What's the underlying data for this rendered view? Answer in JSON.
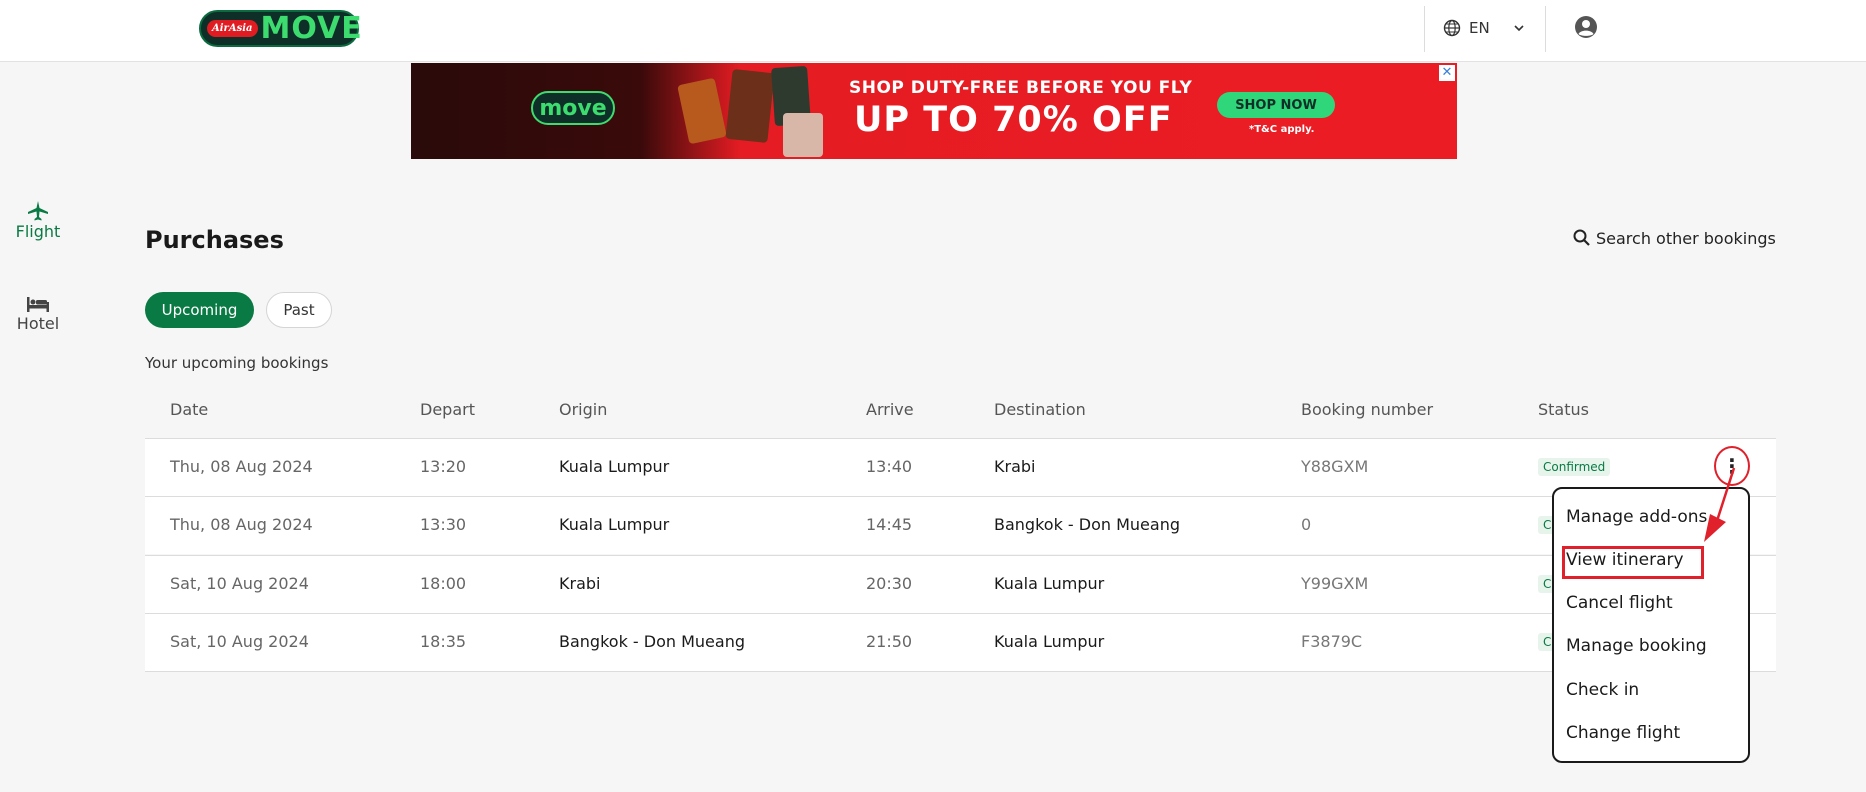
{
  "header": {
    "logo_badge": "AirAsia",
    "logo_text": "MOVE",
    "language": "EN"
  },
  "ad": {
    "logo_text": "move",
    "line1": "SHOP DUTY-FREE BEFORE YOU FLY",
    "line2": "UP TO 70% OFF",
    "cta": "SHOP NOW",
    "tc": "*T&C apply.",
    "close": "✕"
  },
  "sidenav": {
    "flight": "Flight",
    "hotel": "Hotel"
  },
  "main": {
    "title": "Purchases",
    "search_label": "Search other bookings",
    "tabs": {
      "upcoming": "Upcoming",
      "past": "Past"
    },
    "subtitle": "Your upcoming bookings"
  },
  "table": {
    "headers": {
      "date": "Date",
      "depart": "Depart",
      "origin": "Origin",
      "arrive": "Arrive",
      "destination": "Destination",
      "booking": "Booking number",
      "status": "Status"
    },
    "rows": [
      {
        "date": "Thu, 08 Aug 2024",
        "depart": "13:20",
        "origin": "Kuala Lumpur",
        "arrive": "13:40",
        "destination": "Krabi",
        "booking": "Y88GXM",
        "status": "Confirmed"
      },
      {
        "date": "Thu, 08 Aug 2024",
        "depart": "13:30",
        "origin": "Kuala Lumpur",
        "arrive": "14:45",
        "destination": "Bangkok - Don Mueang",
        "booking": "0",
        "status": "Confirmed"
      },
      {
        "date": "Sat, 10 Aug 2024",
        "depart": "18:00",
        "origin": "Krabi",
        "arrive": "20:30",
        "destination": "Kuala Lumpur",
        "booking": "Y99GXM",
        "status": "Confirmed"
      },
      {
        "date": "Sat, 10 Aug 2024",
        "depart": "18:35",
        "origin": "Bangkok - Don Mueang",
        "arrive": "21:50",
        "destination": "Kuala Lumpur",
        "booking": "F3879C",
        "status": "Confirmed"
      }
    ]
  },
  "menu": {
    "kebab": "⋮",
    "items": [
      "Manage add-ons",
      "View itinerary",
      "Cancel flight",
      "Manage booking",
      "Check in",
      "Change flight"
    ]
  },
  "colors": {
    "brand_green": "#0a7a44",
    "annotation_red": "#e0202a"
  }
}
